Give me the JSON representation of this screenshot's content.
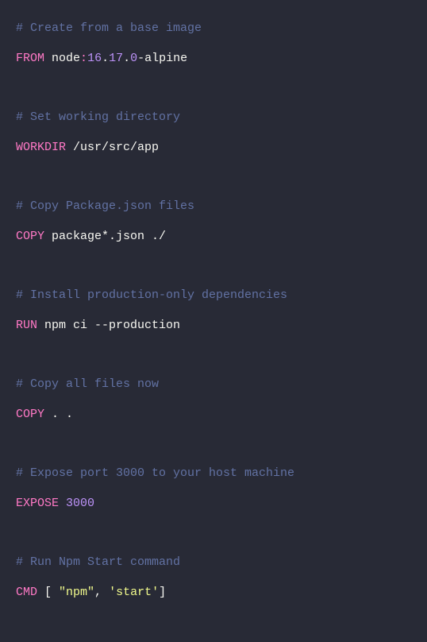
{
  "lines": [
    {
      "type": "comment",
      "text": "# Create from a base image"
    },
    {
      "type": "from",
      "keyword": "FROM",
      "image": "node",
      "colon1": ":",
      "v1": "16",
      "dot1": ".",
      "v2": "17",
      "dot2": ".",
      "v3": "0",
      "suffix": "-alpine"
    },
    {
      "type": "blank"
    },
    {
      "type": "comment",
      "text": "# Set working directory"
    },
    {
      "type": "simple",
      "keyword": "WORKDIR",
      "args": "/usr/src/app"
    },
    {
      "type": "blank"
    },
    {
      "type": "comment",
      "text": "# Copy Package.json files"
    },
    {
      "type": "simple",
      "keyword": "COPY",
      "args": "package*.json ./"
    },
    {
      "type": "blank"
    },
    {
      "type": "comment",
      "text": "# Install production-only dependencies"
    },
    {
      "type": "simple",
      "keyword": "RUN",
      "args": "npm ci --production"
    },
    {
      "type": "blank"
    },
    {
      "type": "comment",
      "text": "# Copy all files now"
    },
    {
      "type": "simple",
      "keyword": "COPY",
      "args": ". ."
    },
    {
      "type": "blank"
    },
    {
      "type": "comment",
      "text": "# Expose port 3000 to your host machine"
    },
    {
      "type": "expose",
      "keyword": "EXPOSE",
      "port": "3000"
    },
    {
      "type": "blank"
    },
    {
      "type": "comment",
      "text": "# Run Npm Start command"
    },
    {
      "type": "cmd",
      "keyword": "CMD",
      "lbracket": " [ ",
      "str1": "\"npm\"",
      "comma": ", ",
      "str2": "'start'",
      "rbracket": "]"
    }
  ]
}
